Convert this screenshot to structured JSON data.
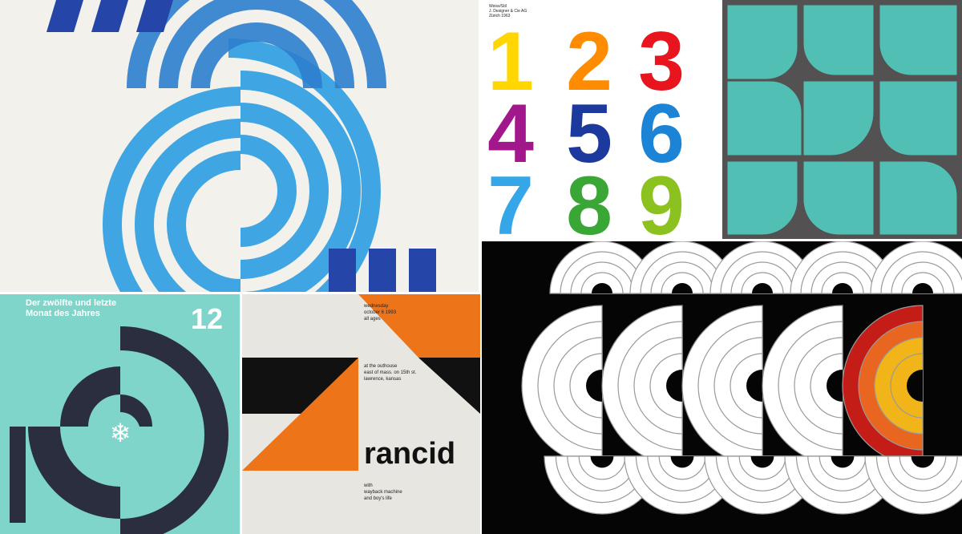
{
  "poster_december": {
    "heading_line1": "Der zwölfte und letzte",
    "heading_line2": "Monat des Jahres",
    "number": "12",
    "icon": "snowflake-icon",
    "colors": {
      "background": "#7fd5c9",
      "shape": "#2a2e3e"
    }
  },
  "poster_numbers": {
    "credit_line1": "Weiss/Stil",
    "credit_line2": "J. Designer & Cie AG",
    "credit_line3": "Zürich 1963",
    "digits": [
      "1",
      "2",
      "3",
      "4",
      "5",
      "6",
      "7",
      "8",
      "9"
    ],
    "colors": [
      "#ffd600",
      "#ff8c00",
      "#e8141e",
      "#a3178c",
      "#1c3a9e",
      "#1c84d6",
      "#35a7e8",
      "#3aa635",
      "#8bc220"
    ]
  },
  "poster_rancid": {
    "date_line1": "wednesday",
    "date_line2": "october 6 1993",
    "date_line3": "all ages",
    "venue_line1": "at the outhouse",
    "venue_line2": "east of mass. on 15th st.",
    "venue_line3": "lawrence, kansas",
    "band": "rancid",
    "support_line1": "with",
    "support_line2": "wayback machine",
    "support_line3": "and boy's life",
    "colors": {
      "orange": "#ee7419",
      "black": "#111111",
      "paper": "#e7e6e0"
    }
  },
  "palette": {
    "blue_light": "#3fa6e3",
    "blue_dark": "#2546a8",
    "teal": "#52bfb4",
    "charcoal": "#535151",
    "red": "#c41c16",
    "orange": "#e8661f",
    "yellow": "#f1b51a"
  }
}
